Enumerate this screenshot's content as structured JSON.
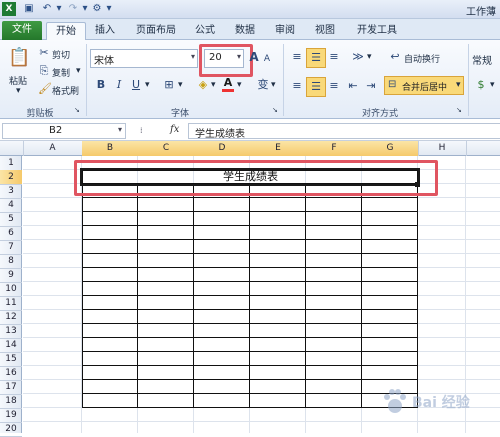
{
  "title_bar": {
    "app_icon": "excel-x",
    "title": "工作薄"
  },
  "tabs": [
    {
      "label": "文件"
    },
    {
      "label": "开始"
    },
    {
      "label": "插入"
    },
    {
      "label": "页面布局"
    },
    {
      "label": "公式"
    },
    {
      "label": "数据"
    },
    {
      "label": "审阅"
    },
    {
      "label": "视图"
    },
    {
      "label": "开发工具"
    }
  ],
  "ribbon": {
    "clipboard": {
      "paste": "粘贴",
      "cut": "剪切",
      "copy": "复制",
      "format_painter": "格式刷",
      "group_label": "剪贴板"
    },
    "font": {
      "font_name": "宋体",
      "font_size": "20",
      "bold": "B",
      "italic": "I",
      "underline": "U",
      "grow": "A",
      "shrink": "A",
      "font_color": "A",
      "phonetic": "变",
      "group_label": "字体"
    },
    "alignment": {
      "wrap_text": "自动换行",
      "merge_center": "合并后居中",
      "group_label": "对齐方式"
    },
    "number": {
      "format": "常规"
    }
  },
  "formula_bar": {
    "name_box": "B2",
    "fx": "fx",
    "content": "学生成绩表"
  },
  "sheet": {
    "columns": [
      "A",
      "B",
      "C",
      "D",
      "E",
      "F",
      "G",
      "H"
    ],
    "selected_columns": [
      "B",
      "C",
      "D",
      "E",
      "F",
      "G"
    ],
    "rows": [
      "1",
      "2",
      "3",
      "4",
      "5",
      "6",
      "7",
      "8",
      "9",
      "10",
      "11",
      "12",
      "13",
      "14",
      "15",
      "16",
      "17",
      "18",
      "19",
      "20"
    ],
    "selected_row": "2",
    "merged_cell_text": "学生成绩表"
  },
  "watermark": "Bai 经验",
  "colors": {
    "file_tab": "#2a7f2f",
    "highlight": "#e05561",
    "selected_header": "#f5c96b",
    "active_toggle": "#f9d979"
  }
}
